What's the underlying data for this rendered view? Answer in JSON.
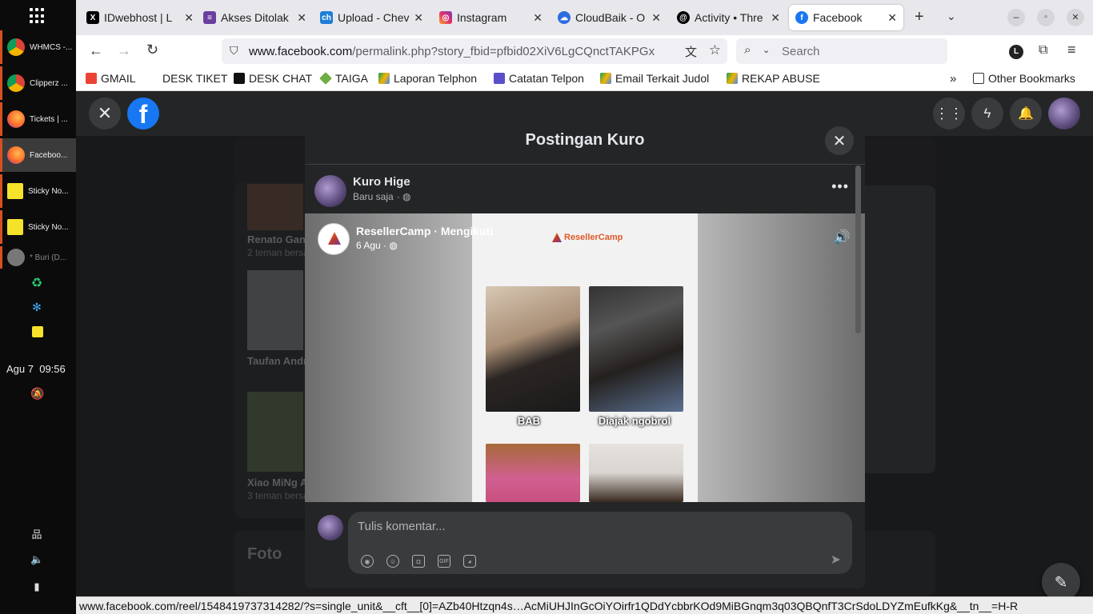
{
  "os": {
    "windows": [
      {
        "label": "WHMCS -...",
        "icon": "chrome-icon"
      },
      {
        "label": "Clipperz ...",
        "icon": "chrome-icon"
      },
      {
        "label": "Tickets | ...",
        "icon": "firefox-icon"
      },
      {
        "label": "Faceboo...",
        "icon": "firefox-icon"
      },
      {
        "label": "Sticky No...",
        "icon": "sticky-notes-icon"
      },
      {
        "label": "Sticky No...",
        "icon": "sticky-notes-icon"
      },
      {
        "label": "* Buri (D...",
        "icon": "app-icon"
      }
    ],
    "date": "Agu 7",
    "time": "09:56"
  },
  "browser": {
    "tabs": [
      {
        "label": "IDwebhost | L",
        "icon": "x-twitter-icon"
      },
      {
        "label": "Akses Ditolak",
        "icon": "list-icon"
      },
      {
        "label": "Upload - Chev",
        "icon": "ch-icon"
      },
      {
        "label": "Instagram",
        "icon": "instagram-icon"
      },
      {
        "label": "CloudBaik - O",
        "icon": "cloud-icon"
      },
      {
        "label": "Activity • Thre",
        "icon": "threads-icon"
      },
      {
        "label": "Facebook",
        "icon": "facebook-icon"
      }
    ],
    "url_host": "www.facebook.com",
    "url_path": "/permalink.php?story_fbid=pfbid02XiV6LgCQnctTAKPGx",
    "search_placeholder": "Search",
    "bookmarks": [
      {
        "label": "GMAIL",
        "color": "#ea4335"
      },
      {
        "label": "DESK TIKET",
        "color": "#ffffff"
      },
      {
        "label": "DESK CHAT",
        "color": "#111111"
      },
      {
        "label": "TAIGA",
        "color": "#6fae43"
      },
      {
        "label": "Laporan Telphon",
        "color": "#1fa463"
      },
      {
        "label": "Catatan Telpon",
        "color": "#5a4ecb"
      },
      {
        "label": "Email Terkait Judol",
        "color": "#1fa463"
      },
      {
        "label": "REKAP ABUSE",
        "color": "#1fa463"
      }
    ],
    "other_bookmarks": "Other Bookmarks",
    "status_url": "www.facebook.com/reel/1548419737314282/?s=single_unit&__cft__[0]=AZb40Htzqn4s…AcMiUHJInGcOiYOirfr1QDdYcbbrKOd9MiBGnqm3q03QBQnfT3CrSdoLDYZmEufkKg&__tn__=H-R"
  },
  "background": {
    "friends": [
      {
        "name": "Renato Gan",
        "sub": "2 teman bersa"
      },
      {
        "name": "Taufan Andri",
        "sub": ""
      },
      {
        "name": "Xiao MiNg Ai",
        "sub": "3 teman bersa"
      }
    ],
    "section_title": "Foto"
  },
  "modal": {
    "title": "Postingan Kuro",
    "author": "Kuro Hige",
    "time": "Baru saja",
    "shared": {
      "page": "ResellerCamp · Mengikuti",
      "date": "6 Agu",
      "logo_text": "ResellerCamp",
      "captions": [
        "BAB",
        "Diajak ngobrol"
      ]
    },
    "comment_placeholder": "Tulis komentar..."
  }
}
